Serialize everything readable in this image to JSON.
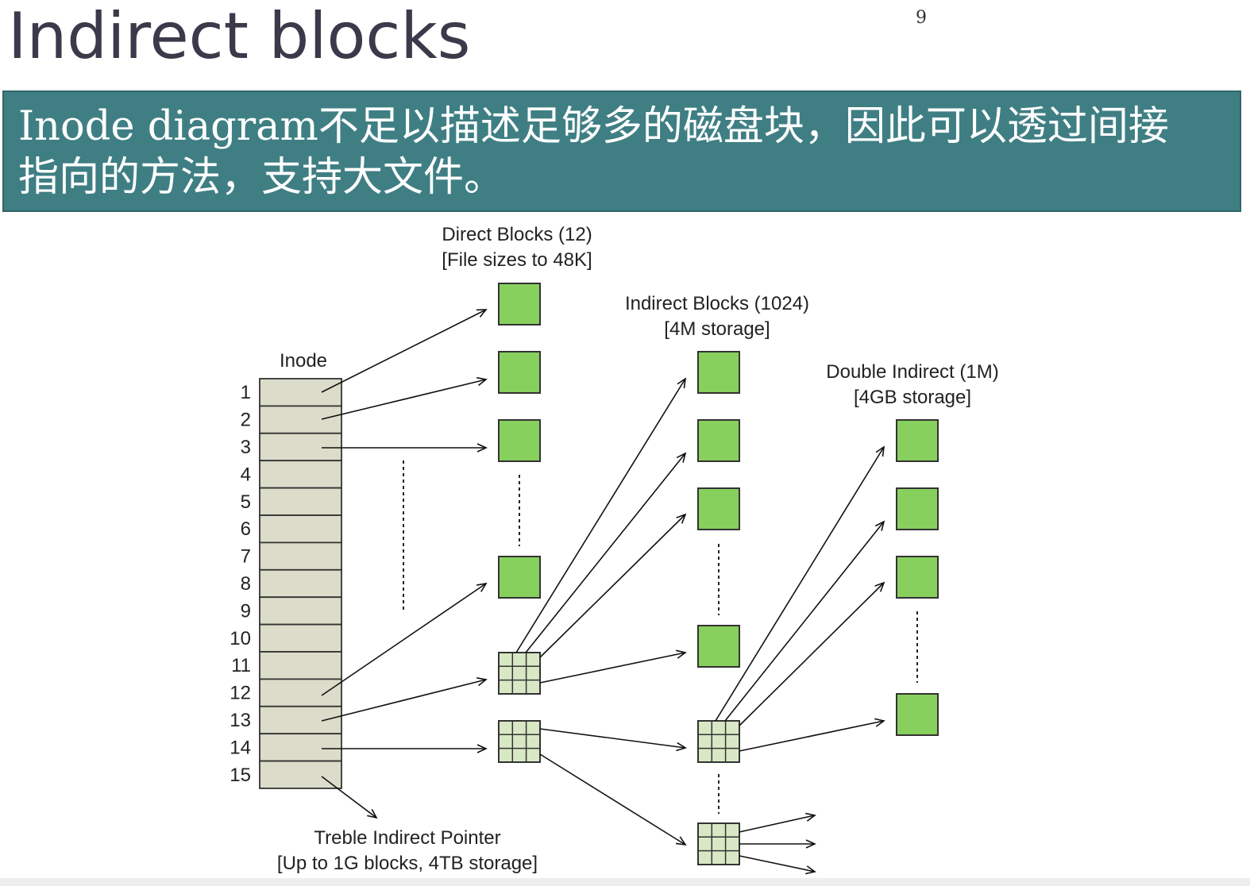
{
  "slide": {
    "title": "Indirect blocks",
    "page_number": "9",
    "banner_line1": "Inode diagram不足以描述足够多的磁盘块，因此可以透过间接",
    "banner_line2": "指向的方法，支持大文件。"
  },
  "diagram": {
    "inode_label": "Inode",
    "inode_slots": [
      "1",
      "2",
      "3",
      "4",
      "5",
      "6",
      "7",
      "8",
      "9",
      "10",
      "11",
      "12",
      "13",
      "14",
      "15"
    ],
    "direct_label_1": "Direct Blocks (12)",
    "direct_label_2": "[File sizes to 48K]",
    "indirect_label_1": "Indirect Blocks (1024)",
    "indirect_label_2": "[4M storage]",
    "double_label_1": "Double Indirect (1M)",
    "double_label_2": "[4GB storage]",
    "treble_label_1": "Treble Indirect Pointer",
    "treble_label_2": "[Up to 1G blocks, 4TB storage]",
    "colors": {
      "data_block": "#88d05e",
      "index_block": "#d9e8c4",
      "inode_cell": "#dcdccb",
      "banner": "#3f7f84"
    }
  }
}
